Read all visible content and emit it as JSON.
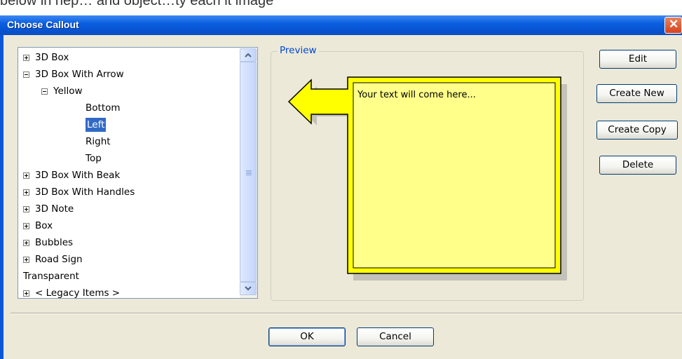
{
  "window": {
    "title": "Choose Callout",
    "close_symbol": "✕",
    "close_icon": "close-icon",
    "title_bar_color": "#0a58d8"
  },
  "top_strip_text": "below in hep… and object…ty each it image",
  "tree": {
    "items": [
      {
        "label": "3D Box",
        "expander": "plus"
      },
      {
        "label": "3D Box With Arrow",
        "expander": "minus"
      },
      {
        "label": "Yellow",
        "expander": "minus"
      },
      {
        "label": "Bottom",
        "expander": "none"
      },
      {
        "label": "Left",
        "expander": "none",
        "selected": true
      },
      {
        "label": "Right",
        "expander": "none"
      },
      {
        "label": "Top",
        "expander": "none"
      },
      {
        "label": "3D Box With Beak",
        "expander": "plus"
      },
      {
        "label": "3D Box With Handles",
        "expander": "plus"
      },
      {
        "label": "3D Note",
        "expander": "plus"
      },
      {
        "label": "Box",
        "expander": "plus"
      },
      {
        "label": "Bubbles",
        "expander": "plus"
      },
      {
        "label": "Road Sign",
        "expander": "plus"
      },
      {
        "label": "Transparent",
        "expander": "none"
      },
      {
        "label": "< Legacy Items >",
        "expander": "plus"
      }
    ],
    "selection_color": "#316ac5"
  },
  "scrollbar": {
    "up_icon": "chevron-up-icon",
    "down_icon": "chevron-down-icon"
  },
  "preview": {
    "label": "Preview",
    "callout_text": "Your text will come here...",
    "callout_fill": "#ffff88",
    "callout_border": "#ffff00",
    "arrow_direction": "left"
  },
  "buttons": {
    "edit": "Edit",
    "create_new": "Create New",
    "create_copy": "Create Copy",
    "delete": "Delete",
    "ok": "OK",
    "cancel": "Cancel"
  }
}
